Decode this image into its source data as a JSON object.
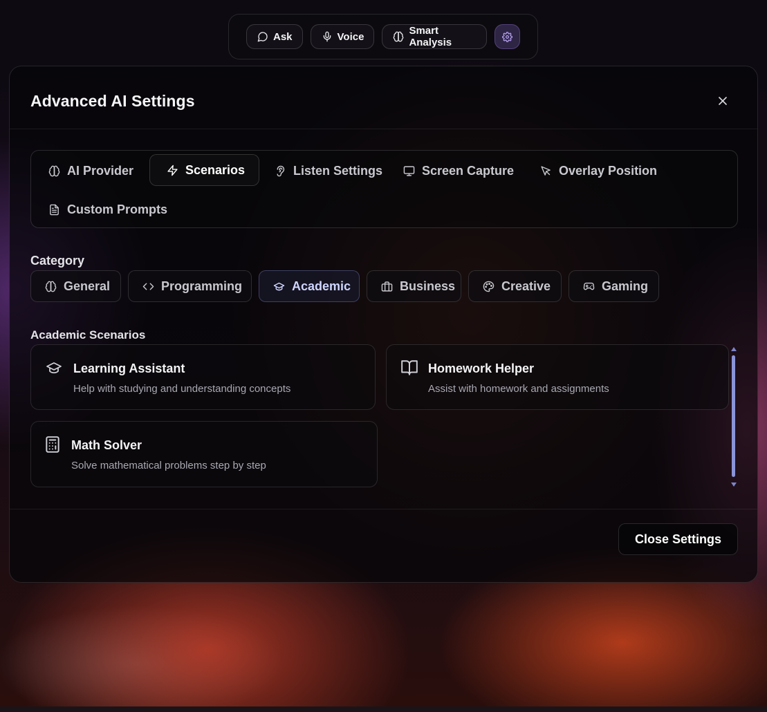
{
  "toolbar": {
    "ask": "Ask",
    "voice": "Voice",
    "smart_analysis": "Smart Analysis",
    "settings_icon": "gear-icon"
  },
  "modal": {
    "title": "Advanced AI Settings",
    "tabs": [
      {
        "label": "AI Provider",
        "icon": "brain-icon"
      },
      {
        "label": "Scenarios",
        "icon": "lightning-icon",
        "active": true
      },
      {
        "label": "Listen Settings",
        "icon": "ear-icon"
      },
      {
        "label": "Screen Capture",
        "icon": "monitor-icon"
      },
      {
        "label": "Overlay Position",
        "icon": "cursor-icon"
      },
      {
        "label": "Custom Prompts",
        "icon": "document-icon"
      }
    ],
    "category_label": "Category",
    "categories": [
      {
        "label": "General",
        "icon": "brain-icon"
      },
      {
        "label": "Programming",
        "icon": "code-icon"
      },
      {
        "label": "Academic",
        "icon": "graduation-cap-icon",
        "active": true
      },
      {
        "label": "Business",
        "icon": "briefcase-icon"
      },
      {
        "label": "Creative",
        "icon": "palette-icon"
      },
      {
        "label": "Gaming",
        "icon": "gamepad-icon"
      }
    ],
    "scenarios_heading": "Academic Scenarios",
    "scenarios": [
      {
        "title": "Learning Assistant",
        "description": "Help with studying and understanding concepts",
        "icon": "graduation-cap-icon"
      },
      {
        "title": "Homework Helper",
        "description": "Assist with homework and assignments",
        "icon": "book-icon"
      },
      {
        "title": "Math Solver",
        "description": "Solve mathematical problems step by step",
        "icon": "calculator-icon"
      }
    ],
    "close_button": "Close Settings"
  },
  "colors": {
    "accent_active_category": "#cfd6ff",
    "scrollbar": "#8a93d8",
    "settings_button_bg": "#302648"
  }
}
